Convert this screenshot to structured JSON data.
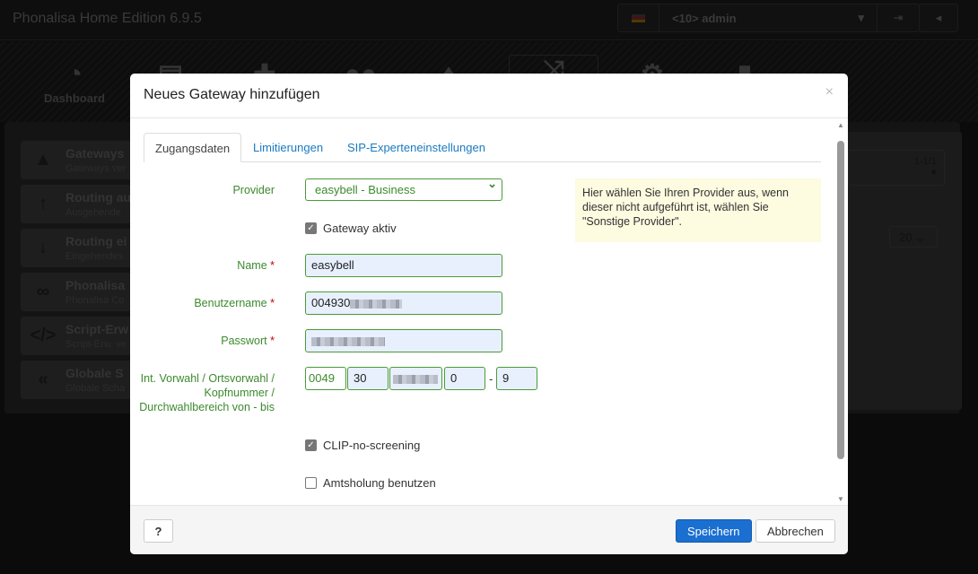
{
  "app": {
    "title": "Phonalisa Home Edition 6.9.5",
    "user": "<10> admin"
  },
  "nav": [
    {
      "label": "Dashboard",
      "icon": "dashboard-icon"
    },
    {
      "label": "",
      "icon": "print-icon"
    },
    {
      "label": "",
      "icon": "puzzle-icon"
    },
    {
      "label": "",
      "icon": "users-icon"
    },
    {
      "label": "",
      "icon": "fire-icon"
    },
    {
      "label": "",
      "icon": "routing-icon"
    },
    {
      "label": "",
      "icon": "settings-icon"
    },
    {
      "label": "",
      "icon": "database-icon"
    }
  ],
  "sidebar": [
    {
      "title": "Gateways",
      "sub": "Gateways ver",
      "icon": "road-icon"
    },
    {
      "title": "Routing au",
      "sub": "Ausgehende",
      "icon": "arrow-up-icon"
    },
    {
      "title": "Routing ei",
      "sub": "Eingehendes",
      "icon": "arrow-down-icon"
    },
    {
      "title": "Phonalisa",
      "sub": "Phonalisa Co",
      "icon": "link-icon"
    },
    {
      "title": "Script-Erw",
      "sub": "Script-Erw. ve",
      "icon": "code-icon"
    },
    {
      "title": "Globale S",
      "sub": "Globale Scha",
      "icon": "reply-all-icon"
    }
  ],
  "background": {
    "pager": "1-1/1",
    "page_size": "20"
  },
  "modal": {
    "title": "Neues Gateway hinzufügen",
    "tabs": [
      "Zugangsdaten",
      "Limitierungen",
      "SIP-Experteneinstellungen"
    ],
    "provider_label": "Provider",
    "provider_value": "easybell - Business",
    "gateway_active_label": "Gateway aktiv",
    "name_label": "Name",
    "name_value": "easybell",
    "username_label": "Benutzername",
    "username_value": "004930",
    "password_label": "Passwort",
    "prefix_label": "Int. Vorwahl / Ortsvorwahl / Kopfnummer / Durchwahlbereich von - bis",
    "prefix": {
      "intl": "0049",
      "area": "30",
      "from": "0",
      "sep": "-",
      "to": "9"
    },
    "clip_label": "CLIP-no-screening",
    "amt_label": "Amtsholung benutzen",
    "help_text": "Hier wählen Sie Ihren Provider aus, wenn dieser nicht aufgeführt ist, wählen Sie \"Sonstige Provider\".",
    "help_button": "?",
    "save": "Speichern",
    "cancel": "Abbrechen",
    "close": "×"
  }
}
